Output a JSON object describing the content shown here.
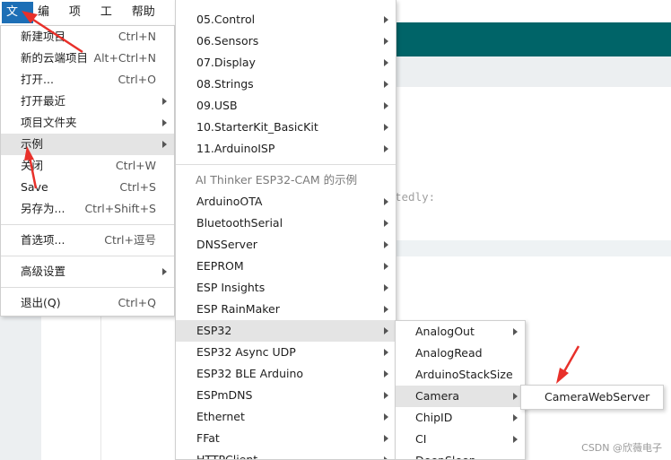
{
  "menubar": [
    "文件",
    "编辑",
    "项目",
    "工具",
    "帮助(H)"
  ],
  "code_fragment": "tedly:",
  "file_menu": {
    "items": [
      {
        "label": "新建项目",
        "shortcut": "Ctrl+N"
      },
      {
        "label": "新的云端项目",
        "shortcut": "Alt+Ctrl+N"
      },
      {
        "label": "打开...",
        "shortcut": "Ctrl+O"
      },
      {
        "label": "打开最近",
        "shortcut": ""
      },
      {
        "label": "项目文件夹",
        "shortcut": ""
      },
      {
        "label": "示例",
        "shortcut": ""
      },
      {
        "label": "关闭",
        "shortcut": "Ctrl+W"
      },
      {
        "label": "Save",
        "shortcut": "Ctrl+S"
      },
      {
        "label": "另存为...",
        "shortcut": "Ctrl+Shift+S"
      },
      {
        "label": "首选项...",
        "shortcut": "Ctrl+逗号"
      },
      {
        "label": "高级设置",
        "shortcut": ""
      },
      {
        "label": "退出(Q)",
        "shortcut": "Ctrl+Q"
      }
    ]
  },
  "examples_menu": {
    "builtin": [
      "05.Control",
      "06.Sensors",
      "07.Display",
      "08.Strings",
      "09.USB",
      "10.StarterKit_BasicKit",
      "11.ArduinoISP"
    ],
    "board_header": "AI Thinker ESP32-CAM 的示例",
    "board": [
      "ArduinoOTA",
      "BluetoothSerial",
      "DNSServer",
      "EEPROM",
      "ESP Insights",
      "ESP RainMaker",
      "ESP32",
      "ESP32 Async UDP",
      "ESP32 BLE Arduino",
      "ESPmDNS",
      "Ethernet",
      "FFat",
      "HTTPClient"
    ]
  },
  "esp32_menu": [
    "AnalogOut",
    "AnalogRead",
    "ArduinoStackSize",
    "Camera",
    "ChipID",
    "CI",
    "DeepSleep"
  ],
  "camera_menu": [
    "CameraWebServer"
  ],
  "watermark": "CSDN @欣薇电子",
  "colors": {
    "accent": "#1d6fb6",
    "header_teal": "#006468",
    "annotation_red": "#e8302a"
  }
}
